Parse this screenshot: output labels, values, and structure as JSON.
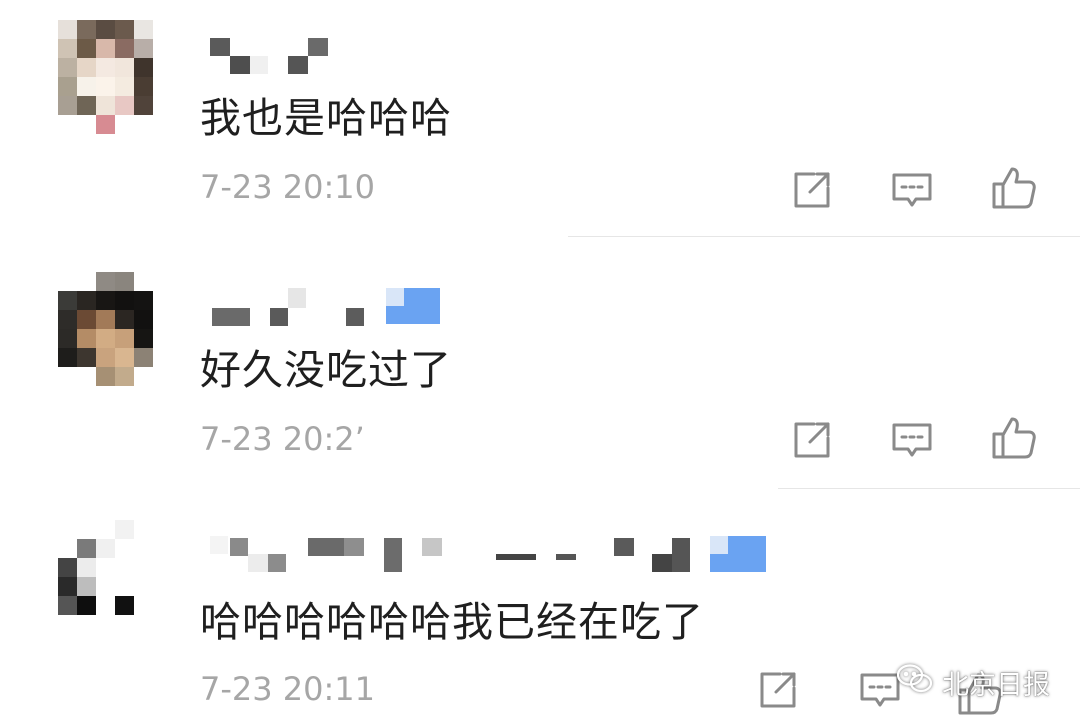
{
  "comments": [
    {
      "text": "我也是哈哈哈",
      "time": "7-23 20:10"
    },
    {
      "text": "好久没吃过了",
      "time": "7-23 20:2’"
    },
    {
      "text": "哈哈哈哈哈哈我已经在吃了",
      "time": "7-23 20:11"
    }
  ],
  "actions": {
    "forward_icon": "share-square-icon",
    "reply_icon": "comment-bubble-icon",
    "like_icon": "thumbs-up-icon"
  },
  "watermark": {
    "label": "北京日报",
    "icon": "wechat-icon"
  },
  "colors": {
    "text": "#1f1f1f",
    "time": "#a6a6a6",
    "icon": "#8a8a8a",
    "divider": "#e6e6e6",
    "vip_badge": "#6aa3f2"
  }
}
